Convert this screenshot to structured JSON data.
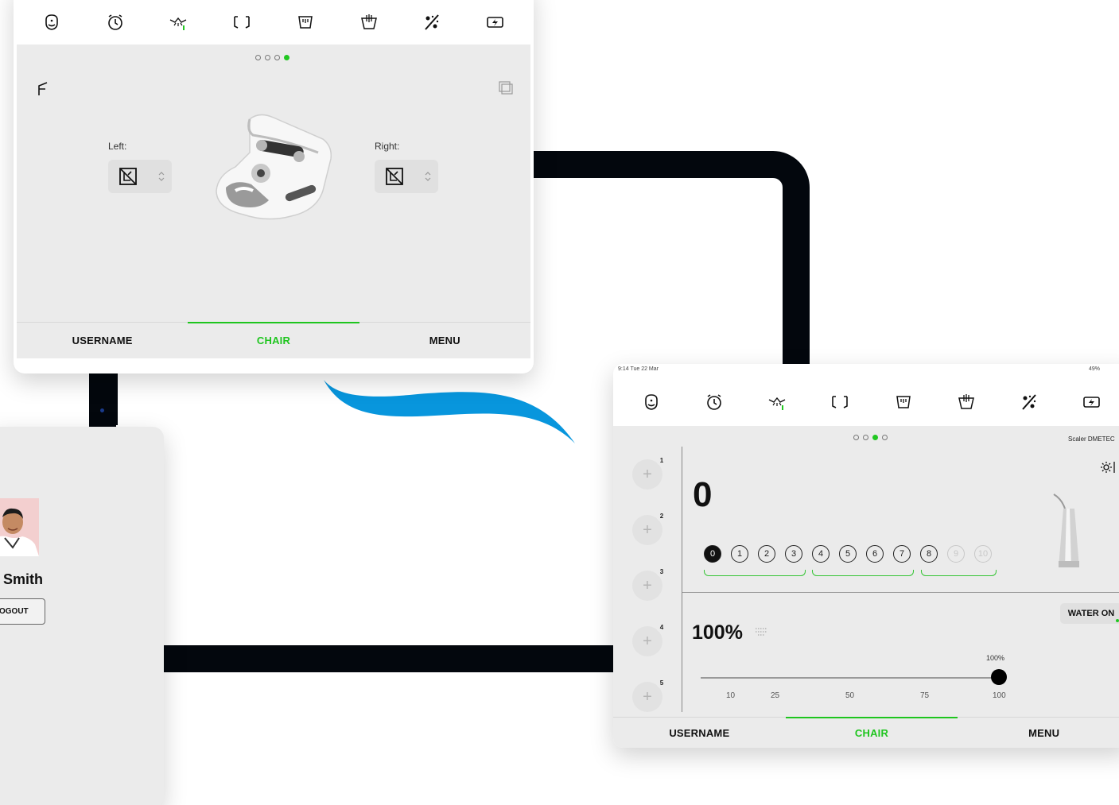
{
  "toolbar_icons": [
    "face-icon",
    "timer-icon",
    "light-icon",
    "scan-icon",
    "cleaning-icon",
    "basin-icon",
    "spray-icon",
    "battery-icon"
  ],
  "chair_panel": {
    "left_label": "Left:",
    "right_label": "Right:",
    "tabs": [
      "USERNAME",
      "CHAIR",
      "MENU"
    ],
    "active_tab": "CHAIR"
  },
  "scaler_panel": {
    "status_time": "9:14  Tue 22 Mar",
    "status_battery": "49%",
    "instrument_name": "Scaler DMETEC",
    "power_level": "0",
    "levels": [
      "0",
      "1",
      "2",
      "3",
      "4",
      "5",
      "6",
      "7",
      "8",
      "9",
      "10"
    ],
    "selected_level": 0,
    "presets": [
      "1",
      "2",
      "3",
      "4",
      "5"
    ],
    "water_percent": "100%",
    "water_button": "WATER ON",
    "slider_value_label": "100%",
    "slider_value": 100,
    "slider_ticks": [
      "10",
      "25",
      "50",
      "75",
      "100"
    ],
    "tabs": [
      "USERNAME",
      "CHAIR",
      "MENU"
    ],
    "active_tab": "CHAIR"
  },
  "user_panel": {
    "name": "r Smith",
    "logout_label": "OGOUT"
  },
  "colors": {
    "accent_green": "#1ec51e",
    "panel_bg": "#ebebeb",
    "swoosh_blue": "#0896dd",
    "frame_black": "#03070d"
  }
}
